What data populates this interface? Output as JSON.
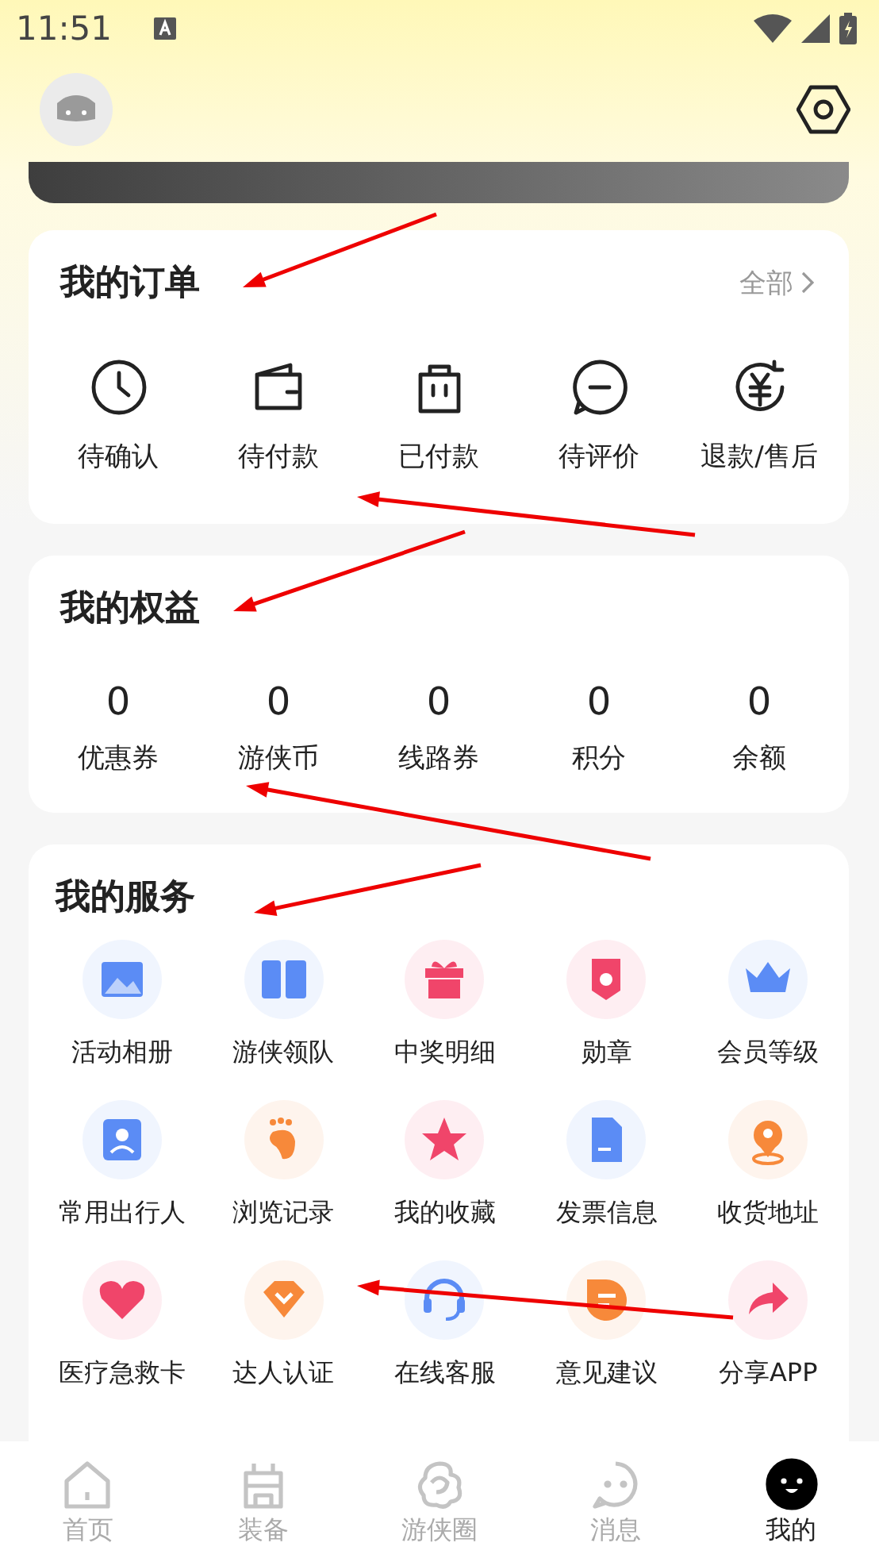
{
  "status_bar": {
    "time": "11:51"
  },
  "orders": {
    "title": "我的订单",
    "more": "全部",
    "items": [
      {
        "label": "待确认"
      },
      {
        "label": "待付款"
      },
      {
        "label": "已付款"
      },
      {
        "label": "待评价"
      },
      {
        "label": "退款/售后"
      }
    ]
  },
  "benefits": {
    "title": "我的权益",
    "items": [
      {
        "value": "0",
        "label": "优惠券"
      },
      {
        "value": "0",
        "label": "游侠币"
      },
      {
        "value": "0",
        "label": "线路券"
      },
      {
        "value": "0",
        "label": "积分"
      },
      {
        "value": "0",
        "label": "余额"
      }
    ]
  },
  "services": {
    "title": "我的服务",
    "items": [
      {
        "label": "活动相册"
      },
      {
        "label": "游侠领队"
      },
      {
        "label": "中奖明细"
      },
      {
        "label": "勋章"
      },
      {
        "label": "会员等级"
      },
      {
        "label": "常用出行人"
      },
      {
        "label": "浏览记录"
      },
      {
        "label": "我的收藏"
      },
      {
        "label": "发票信息"
      },
      {
        "label": "收货地址"
      },
      {
        "label": "医疗急救卡"
      },
      {
        "label": "达人认证"
      },
      {
        "label": "在线客服"
      },
      {
        "label": "意见建议"
      },
      {
        "label": "分享APP"
      }
    ]
  },
  "tabs": [
    {
      "label": "首页",
      "selected": false
    },
    {
      "label": "装备",
      "selected": false
    },
    {
      "label": "游侠圈",
      "selected": false
    },
    {
      "label": "消息",
      "selected": false
    },
    {
      "label": "我的",
      "selected": true
    }
  ]
}
